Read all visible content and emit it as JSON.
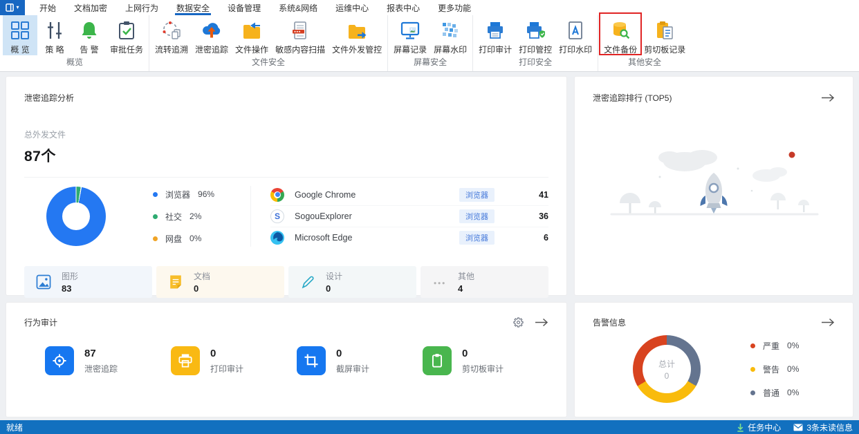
{
  "menu": {
    "items": [
      "开始",
      "文档加密",
      "上网行为",
      "数据安全",
      "设备管理",
      "系统&网络",
      "运维中心",
      "报表中心",
      "更多功能"
    ],
    "active_item": "数据安全"
  },
  "toolbar": {
    "groups": [
      {
        "label": "概览",
        "items": [
          {
            "label": "概 览",
            "icon": "grid-icon",
            "selected": true
          },
          {
            "label": "策 略",
            "icon": "sliders-icon"
          },
          {
            "label": "告 警",
            "icon": "bell-icon"
          },
          {
            "label": "审批任务",
            "icon": "clipboard-check-icon"
          }
        ]
      },
      {
        "label": "文件安全",
        "items": [
          {
            "label": "流转追溯",
            "icon": "trace-cycle-icon"
          },
          {
            "label": "泄密追踪",
            "icon": "cloud-upload-icon"
          },
          {
            "label": "文件操作",
            "icon": "folder-return-icon"
          },
          {
            "label": "敏感内容扫描",
            "icon": "document-scan-icon"
          },
          {
            "label": "文件外发管控",
            "icon": "folder-export-icon"
          }
        ]
      },
      {
        "label": "屏幕安全",
        "items": [
          {
            "label": "屏幕记录",
            "icon": "monitor-icon"
          },
          {
            "label": "屏幕水印",
            "icon": "mosaic-icon"
          }
        ]
      },
      {
        "label": "打印安全",
        "items": [
          {
            "label": "打印审计",
            "icon": "printer-icon"
          },
          {
            "label": "打印管控",
            "icon": "printer-shield-icon"
          },
          {
            "label": "打印水印",
            "icon": "document-a-icon"
          }
        ]
      },
      {
        "label": "其他安全",
        "items": [
          {
            "label": "文件备份",
            "icon": "database-search-icon",
            "highlighted": true
          },
          {
            "label": "剪切板记录",
            "icon": "clipboard-doc-icon"
          }
        ]
      }
    ]
  },
  "leak_analysis": {
    "title": "泄密追踪分析",
    "total_label": "总外发文件",
    "total_value": "87个",
    "legend": [
      {
        "label": "浏览器",
        "pct": "96%",
        "color": "#2478f2"
      },
      {
        "label": "社交",
        "pct": "2%",
        "color": "#2eab71"
      },
      {
        "label": "网盘",
        "pct": "0%",
        "color": "#f0a426"
      }
    ],
    "apps": [
      {
        "name": "Google Chrome",
        "tag": "浏览器",
        "value": "41"
      },
      {
        "name": "SogouExplorer",
        "tag": "浏览器",
        "value": "36"
      },
      {
        "name": "Microsoft Edge",
        "tag": "浏览器",
        "value": "6"
      }
    ],
    "cards": [
      {
        "label": "图形",
        "value": "83"
      },
      {
        "label": "文档",
        "value": "0"
      },
      {
        "label": "设计",
        "value": "0"
      },
      {
        "label": "其他",
        "value": "4"
      }
    ]
  },
  "leak_rank": {
    "title": "泄密追踪排行 (TOP5)"
  },
  "behavior_audit": {
    "title": "行为审计",
    "stats": [
      {
        "value": "87",
        "label": "泄密追踪",
        "color": "#1677f0"
      },
      {
        "value": "0",
        "label": "打印审计",
        "color": "#f9b913"
      },
      {
        "value": "0",
        "label": "截屏审计",
        "color": "#1677f0"
      },
      {
        "value": "0",
        "label": "剪切板审计",
        "color": "#49b64e"
      }
    ]
  },
  "alerts": {
    "title": "告警信息",
    "center_label": "总计",
    "center_value": "0",
    "legend": [
      {
        "label": "严重",
        "pct": "0%",
        "color": "#d8431f"
      },
      {
        "label": "警告",
        "pct": "0%",
        "color": "#f9bb0c"
      },
      {
        "label": "普通",
        "pct": "0%",
        "color": "#64748f"
      }
    ]
  },
  "status_bar": {
    "ready": "就绪",
    "task_center": "任务中心",
    "unread": "3条未读信息"
  },
  "chart_data": [
    {
      "type": "pie",
      "title": "泄密追踪分析-外发渠道占比",
      "categories": [
        "浏览器",
        "社交",
        "网盘"
      ],
      "values": [
        96,
        2,
        0
      ],
      "unit": "%"
    },
    {
      "type": "pie",
      "title": "告警信息",
      "categories": [
        "严重",
        "警告",
        "普通"
      ],
      "values": [
        0,
        0,
        0
      ],
      "center_total": 0,
      "unit": "%"
    }
  ],
  "colors": {
    "accent": "#1767c2",
    "statusbar": "#1270bf",
    "ribbon_selected": "#cfe4f6",
    "highlight_box": "#e02424"
  }
}
